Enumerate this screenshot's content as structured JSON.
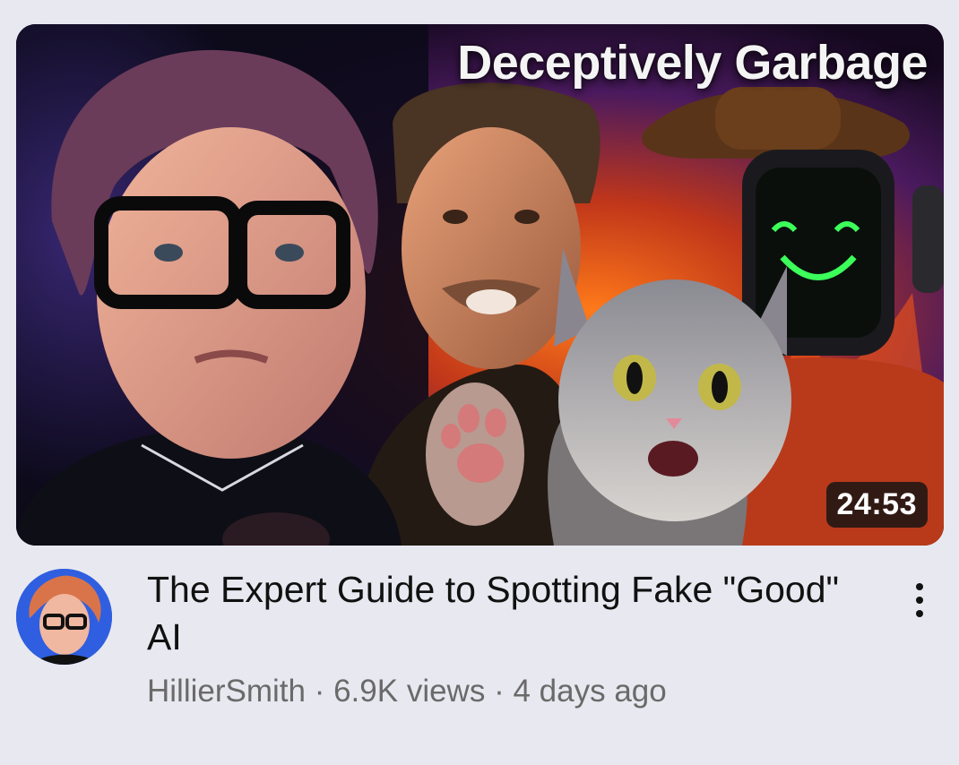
{
  "video": {
    "thumbnail_text": "Deceptively Garbage",
    "duration": "24:53",
    "title": "The Expert Guide to Spotting Fake \"Good\" AI",
    "channel": "HillierSmith",
    "separator": "·",
    "views": "6.9K views",
    "age": "4 days ago"
  },
  "icons": {
    "menu": "more-vertical-icon",
    "avatar": "channel-avatar"
  },
  "colors": {
    "background": "#e8e8f0",
    "title_text": "#111111",
    "meta_text": "#6a6a6a",
    "duration_badge": "#141414"
  }
}
